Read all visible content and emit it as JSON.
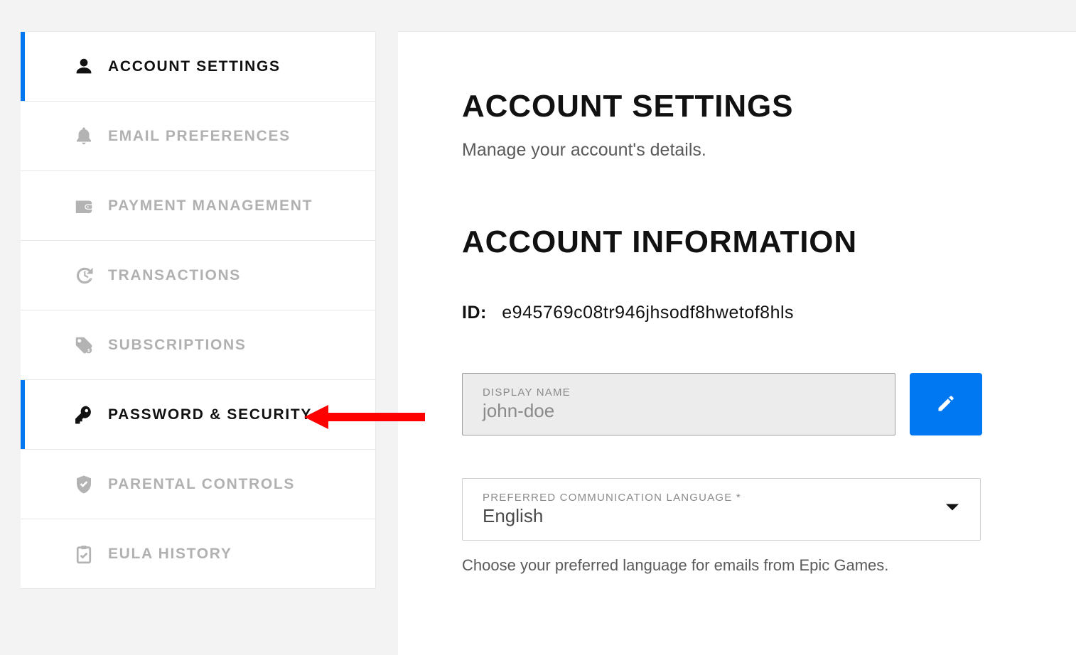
{
  "sidebar": {
    "items": [
      {
        "label": "ACCOUNT SETTINGS"
      },
      {
        "label": "EMAIL PREFERENCES"
      },
      {
        "label": "PAYMENT MANAGEMENT"
      },
      {
        "label": "TRANSACTIONS"
      },
      {
        "label": "SUBSCRIPTIONS"
      },
      {
        "label": "PASSWORD & SECURITY"
      },
      {
        "label": "PARENTAL CONTROLS"
      },
      {
        "label": "EULA HISTORY"
      }
    ]
  },
  "main": {
    "title": "ACCOUNT SETTINGS",
    "subtitle": "Manage your account's details.",
    "section_title": "ACCOUNT INFORMATION",
    "id_label": "ID:",
    "id_value": "e945769c08tr946jhsodf8hwetof8hls",
    "display_name": {
      "label": "DISPLAY NAME",
      "value": "john-doe"
    },
    "language": {
      "label": "PREFERRED COMMUNICATION LANGUAGE *",
      "value": "English",
      "helper": "Choose your preferred language for emails from Epic Games."
    }
  },
  "colors": {
    "accent": "#0078f2"
  }
}
